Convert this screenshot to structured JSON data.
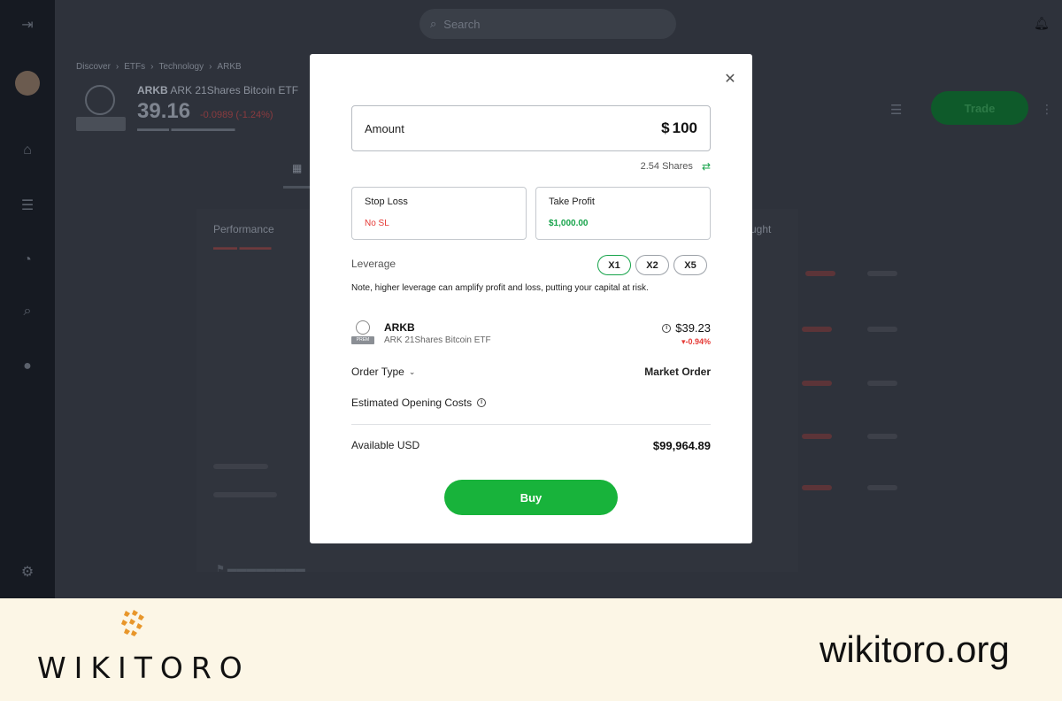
{
  "background": {
    "search_placeholder": "Search",
    "breadcrumbs": [
      "Discover",
      "ETFs",
      "Technology",
      "ARKB"
    ],
    "asset_symbol": "ARKB",
    "asset_name": "ARK 21Shares Bitcoin ETF",
    "asset_price": "39.16",
    "asset_change": "-0.0989 (-1.24%)",
    "trade_label": "Trade",
    "performance_label": "Performance",
    "ought_label": "ught"
  },
  "modal": {
    "amount": {
      "label": "Amount",
      "currency": "$",
      "value": "100"
    },
    "shares": "2.54 Shares",
    "stop_loss": {
      "label": "Stop Loss",
      "value": "No SL"
    },
    "take_profit": {
      "label": "Take Profit",
      "value": "$1,000.00"
    },
    "leverage": {
      "label": "Leverage",
      "options": [
        "X1",
        "X2",
        "X5"
      ],
      "selected": "X1",
      "note": "Note, higher leverage can amplify profit and loss, putting your capital at risk."
    },
    "asset": {
      "symbol": "ARKB",
      "name": "ARK 21Shares Bitcoin ETF",
      "price": "$39.23",
      "change": "-0.94%"
    },
    "order_type": {
      "label": "Order Type",
      "value": "Market Order"
    },
    "costs_label": "Estimated Opening Costs",
    "available": {
      "label": "Available USD",
      "value": "$99,964.89"
    },
    "buy_label": "Buy"
  },
  "watermark": {
    "brand": "WIKITORO",
    "url": "wikitoro.org"
  },
  "colors": {
    "accent_green": "#18b33b",
    "loss_red": "#e53935",
    "banner_bg": "#fcf6e6"
  }
}
